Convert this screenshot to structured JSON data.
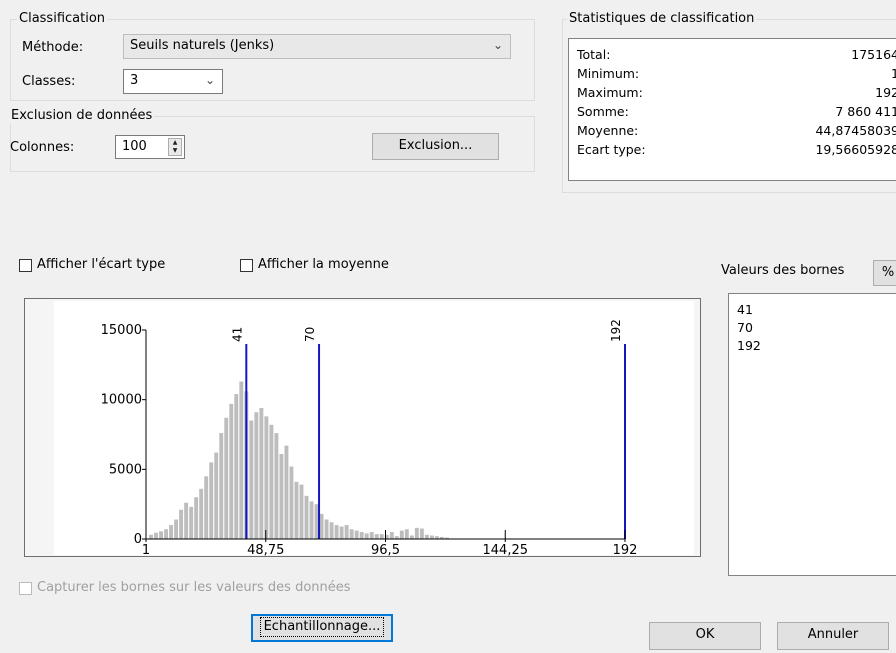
{
  "classification": {
    "title": "Classification",
    "method_label": "Méthode:",
    "method_value": "Seuils naturels (Jenks)",
    "classes_label": "Classes:",
    "classes_value": "3"
  },
  "exclusion": {
    "title": "Exclusion de données",
    "columns_label": "Colonnes:",
    "columns_value": "100",
    "button": "Exclusion..."
  },
  "stats": {
    "title": "Statistiques de classification",
    "rows": [
      {
        "label": "Total:",
        "value": "175164"
      },
      {
        "label": "Minimum:",
        "value": "1"
      },
      {
        "label": "Maximum:",
        "value": "192"
      },
      {
        "label": "Somme:",
        "value": "7 860 411"
      },
      {
        "label": "Moyenne:",
        "value": "44,87458039"
      },
      {
        "label": "Ecart type:",
        "value": "19,56605928"
      }
    ]
  },
  "options": {
    "show_std": "Afficher l'écart type",
    "show_mean": "Afficher la moyenne",
    "snap_breaks": "Capturer les bornes sur les valeurs des données"
  },
  "breaks": {
    "title": "Valeurs des bornes",
    "percent_button": "%",
    "values": [
      "41",
      "70",
      "192"
    ]
  },
  "buttons": {
    "sampling": "Echantillonnage...",
    "ok": "OK",
    "cancel": "Annuler"
  },
  "colors": {
    "bar": "#bdbdbd",
    "break_line": "#1616c4",
    "focus": "#0078d7"
  },
  "chart_data": {
    "type": "bar",
    "x_tick_labels": [
      "1",
      "48,75",
      "96,5",
      "144,25",
      "192"
    ],
    "y_tick_labels": [
      "0",
      "5000",
      "10000",
      "15000"
    ],
    "xlim": [
      1,
      192
    ],
    "ylim": [
      0,
      15000
    ],
    "break_values": [
      41,
      70,
      192
    ],
    "break_labels": [
      "41",
      "70",
      "192"
    ],
    "x": [
      3,
      5,
      7,
      9,
      11,
      13,
      15,
      17,
      19,
      21,
      23,
      25,
      27,
      29,
      31,
      33,
      35,
      37,
      39,
      41,
      43,
      45,
      47,
      49,
      51,
      53,
      55,
      57,
      59,
      61,
      63,
      65,
      67,
      69,
      71,
      73,
      75,
      77,
      79,
      81,
      83,
      85,
      87,
      89,
      91,
      93,
      95,
      97,
      99,
      101,
      103,
      105,
      107,
      109,
      111,
      113,
      115,
      117,
      119,
      121
    ],
    "values": [
      300,
      450,
      550,
      700,
      1000,
      1400,
      2100,
      2600,
      2300,
      3000,
      3600,
      4500,
      5500,
      6200,
      7600,
      8700,
      9700,
      10400,
      11300,
      10600,
      8500,
      9100,
      9400,
      8800,
      8200,
      7600,
      6100,
      6700,
      5200,
      4100,
      3900,
      3100,
      2700,
      2500,
      1800,
      1400,
      1200,
      1000,
      900,
      1000,
      700,
      600,
      500,
      400,
      500,
      350,
      350,
      300,
      500,
      200,
      600,
      700,
      250,
      800,
      750,
      300,
      250,
      200,
      150,
      100
    ]
  }
}
